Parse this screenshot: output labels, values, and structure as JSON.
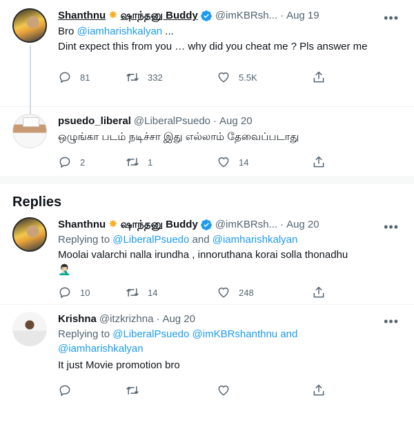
{
  "tweets": [
    {
      "name": "Shanthnu",
      "name_tamil": "ஷாந்தனு Buddy",
      "handle": "@imKBRsh...",
      "date": "Aug 19",
      "lines": [
        "Bro ",
        "@iamharishkalyan",
        " ...",
        "Dint expect this from you … why did you cheat me ? Pls answer me"
      ],
      "replies": "81",
      "retweets": "332",
      "likes": "5.5K"
    },
    {
      "name": "psuedo_liberal",
      "handle": "@LiberalPsuedo",
      "date": "Aug 20",
      "text": "ஒழுங்கா படம் நடிச்சா இது எல்லாம் தேவைப்படாது",
      "replies": "2",
      "retweets": "1",
      "likes": "14"
    }
  ],
  "replies_heading": "Replies",
  "replies": [
    {
      "name": "Shanthnu",
      "name_tamil": "ஷாந்தனு Buddy",
      "handle": "@imKBRsh...",
      "date": "Aug 20",
      "replying_prefix": "Replying to ",
      "replying_a": "@LiberalPsuedo",
      "replying_and": " and ",
      "replying_b": "@iamharishkalyan",
      "text": "Moolai valarchi nalla irundha , innoruthana korai solla thonadhu",
      "emoji": "🤦🏻‍♂️",
      "replies": "10",
      "retweets": "14",
      "likes": "248"
    },
    {
      "name": "Krishna",
      "handle": "@itzkrizhna",
      "date": "Aug 20",
      "replying_prefix": "Replying to ",
      "replying_a": "@LiberalPsuedo",
      "replying_mid": " ",
      "replying_b": "@imKBRshanthnu",
      "replying_and": " and",
      "replying_c": "@iamharishkalyan",
      "text": "It just Movie promotion bro",
      "replies": "",
      "retweets": "",
      "likes": ""
    }
  ],
  "icons": {
    "reply": "reply-icon",
    "retweet": "retweet-icon",
    "like": "heart-icon",
    "share": "share-icon",
    "more": "more-icon",
    "verified": "verified-badge-icon",
    "star": "star-emoji"
  },
  "colors": {
    "accent": "#1d9bf0",
    "muted": "#536471",
    "text": "#0f1419"
  }
}
